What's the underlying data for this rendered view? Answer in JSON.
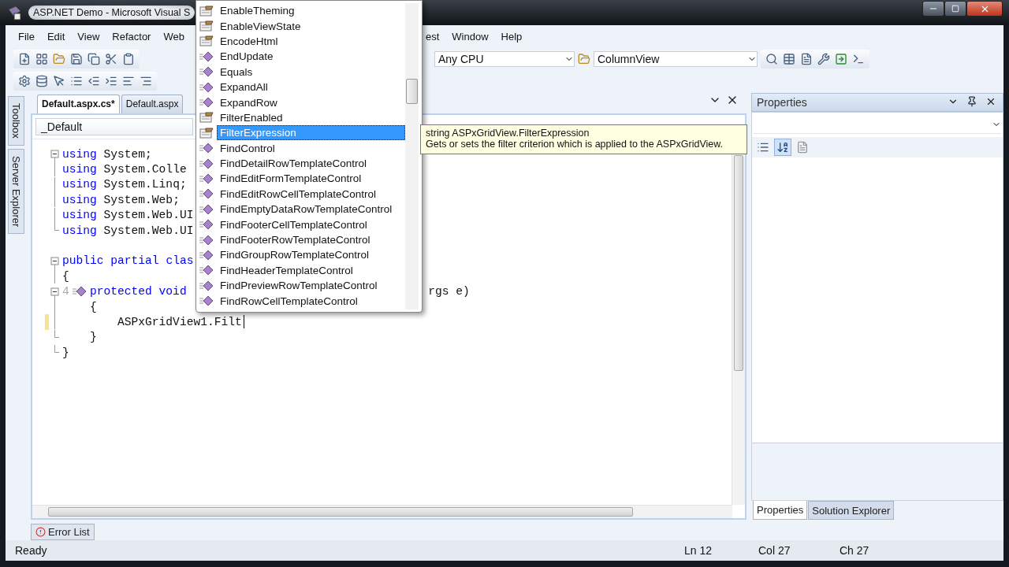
{
  "window": {
    "title": "ASP.NET Demo - Microsoft Visual S"
  },
  "menu": {
    "left": [
      "File",
      "Edit",
      "View",
      "Refactor",
      "Web"
    ],
    "right": [
      "est",
      "Window",
      "Help"
    ]
  },
  "toolbar": {
    "platform_combo": {
      "value": "Any CPU"
    },
    "find_combo": {
      "value": "ColumnView"
    }
  },
  "side_tabs": [
    "Toolbox",
    "Server Explorer"
  ],
  "editor": {
    "tabs": [
      {
        "label": "Default.aspx.cs*",
        "selected": true
      },
      {
        "label": "Default.aspx",
        "selected": false
      }
    ],
    "type_combo": {
      "value": "_Default"
    },
    "lines": [
      {
        "kind": "code",
        "text": "using System;",
        "fold_start": true,
        "fold_end": false,
        "changed": false
      },
      {
        "kind": "code",
        "text": "using System.Colle",
        "fold_start": false,
        "fold_end": false,
        "changed": false
      },
      {
        "kind": "code",
        "text": "using System.Linq;",
        "fold_start": false,
        "fold_end": false,
        "changed": false
      },
      {
        "kind": "code",
        "text": "using System.Web;",
        "fold_start": false,
        "fold_end": false,
        "changed": false
      },
      {
        "kind": "code",
        "text": "using System.Web.UI",
        "fold_start": false,
        "fold_end": false,
        "changed": false
      },
      {
        "kind": "code",
        "text": "using System.Web.UI",
        "fold_start": false,
        "fold_end": true,
        "changed": false
      },
      {
        "kind": "blank"
      },
      {
        "kind": "code",
        "text": "public partial clas",
        "fold_start": true,
        "fold_end": false,
        "changed": false
      },
      {
        "kind": "code",
        "text": "{",
        "fold_start": false,
        "fold_end": false,
        "changed": false
      },
      {
        "kind": "member",
        "marker": "4",
        "text": "protected void",
        "tail": "rgs e)",
        "fold_start": true,
        "fold_end": false,
        "changed": false
      },
      {
        "kind": "code",
        "text": "    {",
        "fold_start": false,
        "fold_end": false,
        "changed": false
      },
      {
        "kind": "code",
        "text": "        ASPxGridView1.Filt",
        "fold_start": false,
        "fold_end": false,
        "changed": true,
        "caret": true
      },
      {
        "kind": "code",
        "text": "    }",
        "fold_start": false,
        "fold_end": true,
        "changed": false
      },
      {
        "kind": "code",
        "text": "}",
        "fold_start": false,
        "fold_end": true,
        "changed": false
      }
    ]
  },
  "completion_list": [
    {
      "kind": "property",
      "label": "EnableTheming",
      "selected": false
    },
    {
      "kind": "property",
      "label": "EnableViewState",
      "selected": false
    },
    {
      "kind": "property",
      "label": "EncodeHtml",
      "selected": false
    },
    {
      "kind": "method",
      "label": "EndUpdate",
      "selected": false
    },
    {
      "kind": "method",
      "label": "Equals",
      "selected": false
    },
    {
      "kind": "method",
      "label": "ExpandAll",
      "selected": false
    },
    {
      "kind": "method",
      "label": "ExpandRow",
      "selected": false
    },
    {
      "kind": "property",
      "label": "FilterEnabled",
      "selected": false
    },
    {
      "kind": "property",
      "label": "FilterExpression",
      "selected": true
    },
    {
      "kind": "method",
      "label": "FindControl",
      "selected": false
    },
    {
      "kind": "method",
      "label": "FindDetailRowTemplateControl",
      "selected": false
    },
    {
      "kind": "method",
      "label": "FindEditFormTemplateControl",
      "selected": false
    },
    {
      "kind": "method",
      "label": "FindEditRowCellTemplateControl",
      "selected": false
    },
    {
      "kind": "method",
      "label": "FindEmptyDataRowTemplateControl",
      "selected": false
    },
    {
      "kind": "method",
      "label": "FindFooterCellTemplateControl",
      "selected": false
    },
    {
      "kind": "method",
      "label": "FindFooterRowTemplateControl",
      "selected": false
    },
    {
      "kind": "method",
      "label": "FindGroupRowTemplateControl",
      "selected": false
    },
    {
      "kind": "method",
      "label": "FindHeaderTemplateControl",
      "selected": false
    },
    {
      "kind": "method",
      "label": "FindPreviewRowTemplateControl",
      "selected": false
    },
    {
      "kind": "method",
      "label": "FindRowCellTemplateControl",
      "selected": false
    }
  ],
  "tooltip": {
    "signature": "string ASPxGridView.FilterExpression",
    "description": "Gets or sets the filter criterion which is applied to the ASPxGridView."
  },
  "properties_panel": {
    "title": "Properties",
    "tabs": [
      {
        "label": "Properties",
        "selected": true
      },
      {
        "label": "Solution Explorer",
        "selected": false
      }
    ]
  },
  "bottom_tabs": [
    "Error List"
  ],
  "status_bar": {
    "message": "Ready",
    "line": "Ln 12",
    "column": "Col 27",
    "char": "Ch 27"
  }
}
